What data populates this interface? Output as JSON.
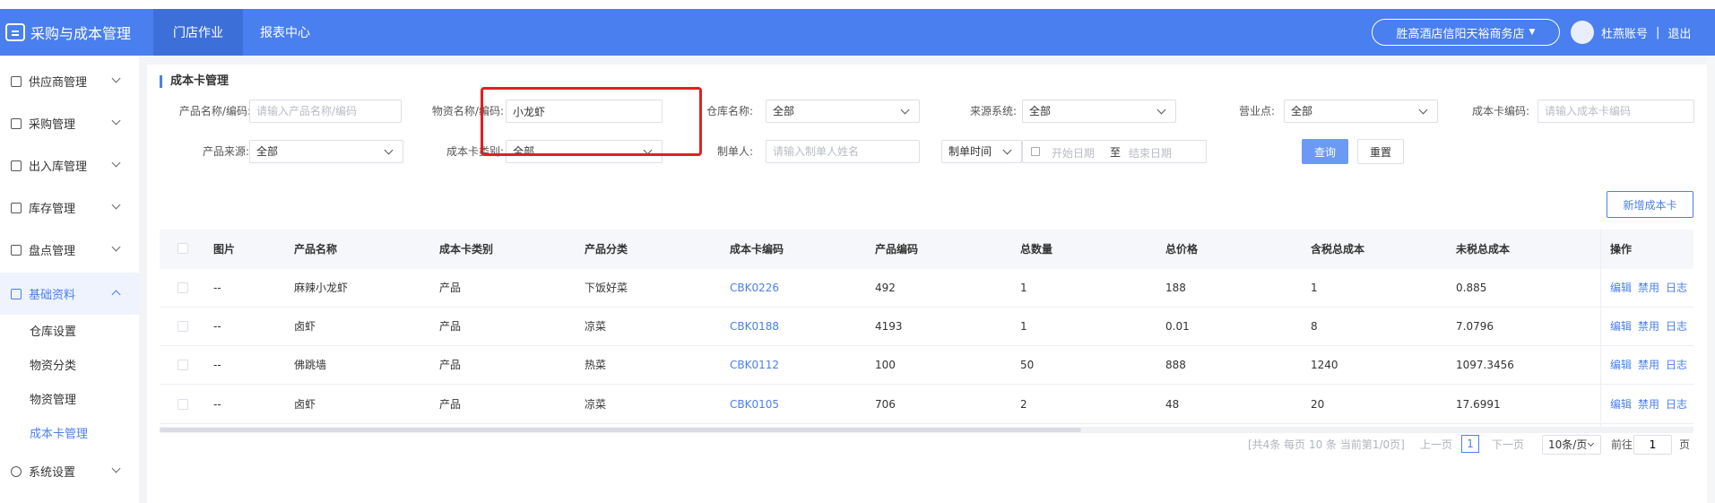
{
  "app": {
    "title": "采购与成本管理"
  },
  "topnav": {
    "tabs": [
      "门店作业",
      "报表中心"
    ]
  },
  "store": {
    "name": "胜高酒店信阳天裕商务店"
  },
  "user": {
    "name": "杜燕账号",
    "separator": "|",
    "logout": "退出"
  },
  "sidebar": {
    "items": [
      {
        "label": "供应商管理"
      },
      {
        "label": "采购管理"
      },
      {
        "label": "出入库管理"
      },
      {
        "label": "库存管理"
      },
      {
        "label": "盘点管理"
      },
      {
        "label": "基础资料"
      },
      {
        "label": "系统设置"
      }
    ],
    "subitems": [
      "仓库设置",
      "物资分类",
      "物资管理",
      "成本卡管理"
    ]
  },
  "page": {
    "title": "成本卡管理"
  },
  "filters": {
    "product_label": "产品名称/编码:",
    "product_placeholder": "请输入产品名称/编码",
    "material_label": "物资名称/编码:",
    "material_value": "小龙虾",
    "warehouse_label": "仓库名称:",
    "warehouse_value": "全部",
    "source_system_label": "来源系统:",
    "source_system_value": "全部",
    "business_point_label": "营业点:",
    "business_point_value": "全部",
    "card_code_label": "成本卡编码:",
    "card_code_placeholder": "请输入成本卡编码",
    "product_source_label": "产品来源:",
    "product_source_value": "全部",
    "card_type_label": "成本卡类别:",
    "card_type_value": "全部",
    "creator_label": "制单人:",
    "creator_placeholder": "请输入制单人姓名",
    "time_type_value": "制单时间",
    "date_start_placeholder": "开始日期",
    "date_to": "至",
    "date_end_placeholder": "结束日期",
    "query_button": "查询",
    "reset_button": "重置"
  },
  "actions": {
    "new_card": "新增成本卡"
  },
  "table": {
    "columns": [
      "图片",
      "产品名称",
      "成本卡类别",
      "产品分类",
      "成本卡编码",
      "产品编码",
      "总数量",
      "总价格",
      "含税总成本",
      "未税总成本",
      "操作"
    ],
    "rows": [
      {
        "image": "--",
        "product": "麻辣小龙虾",
        "card_type": "产品",
        "category": "下饭好菜",
        "card_code": "CBK0226",
        "product_code": "492",
        "qty": "1",
        "price": "188",
        "tax_cost": "1",
        "untax_cost": "0.885"
      },
      {
        "image": "--",
        "product": "卤虾",
        "card_type": "产品",
        "category": "凉菜",
        "card_code": "CBK0188",
        "product_code": "4193",
        "qty": "1",
        "price": "0.01",
        "tax_cost": "8",
        "untax_cost": "7.0796"
      },
      {
        "image": "--",
        "product": "佛跳墙",
        "card_type": "产品",
        "category": "热菜",
        "card_code": "CBK0112",
        "product_code": "100",
        "qty": "50",
        "price": "888",
        "tax_cost": "1240",
        "untax_cost": "1097.3456"
      },
      {
        "image": "--",
        "product": "卤虾",
        "card_type": "产品",
        "category": "凉菜",
        "card_code": "CBK0105",
        "product_code": "706",
        "qty": "2",
        "price": "48",
        "tax_cost": "20",
        "untax_cost": "17.6991"
      }
    ],
    "ops": [
      "编辑",
      "禁用",
      "日志"
    ]
  },
  "pagination": {
    "summary": "[共4条 每页 10 条 当前第1/0页]",
    "prev": "上一页",
    "current": "1",
    "next": "下一页",
    "page_size": "10条/页",
    "goto_label": "前往",
    "goto_value": "1",
    "goto_unit": "页"
  },
  "colors": {
    "primary": "#4a7ff0",
    "highlight": "#e02020"
  }
}
